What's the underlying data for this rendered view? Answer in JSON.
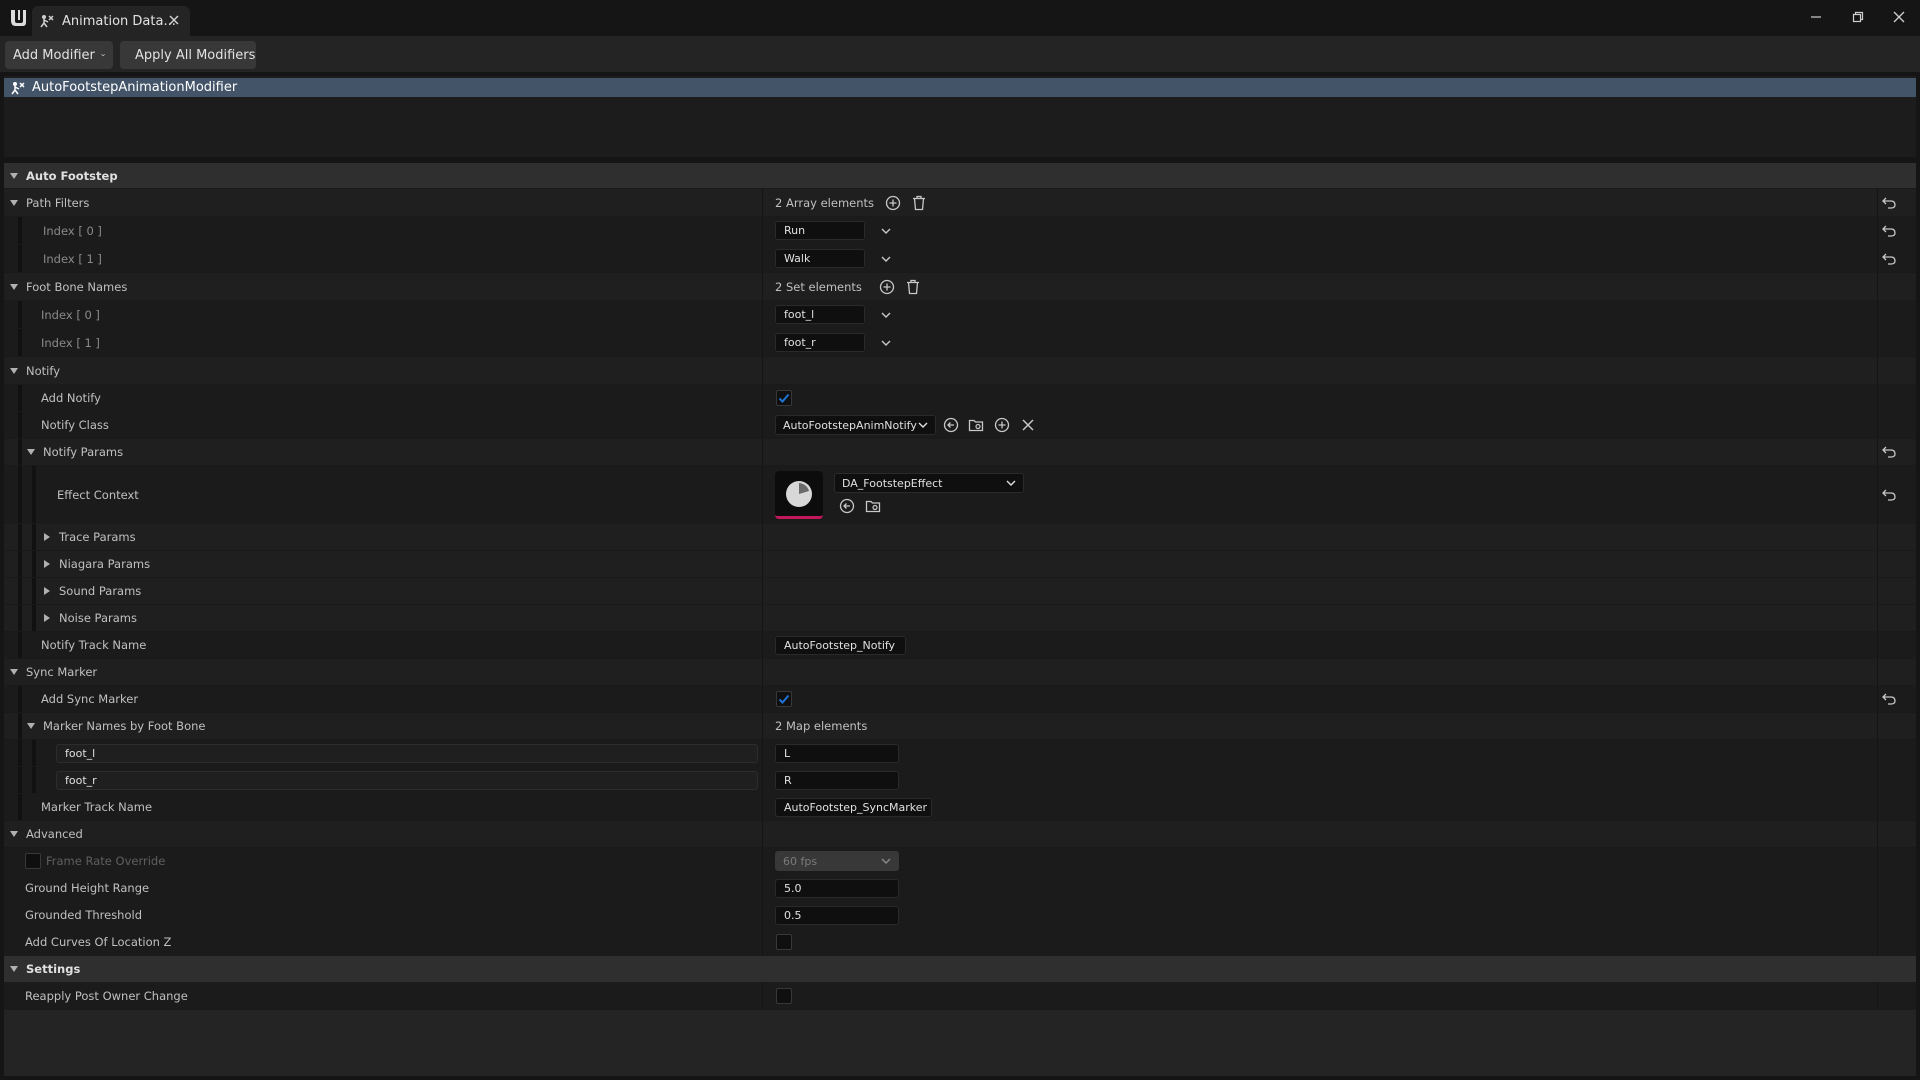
{
  "window": {
    "tab_title": "Animation Data...",
    "tab_icon": "animation-modifier-icon",
    "controls": [
      "minimize-icon",
      "restore-icon",
      "close-icon"
    ]
  },
  "toolbar": {
    "add_modifier_label": "Add Modifier",
    "apply_all_label": "Apply All Modifiers"
  },
  "modifiers": {
    "selected": "AutoFootstepAnimationModifier"
  },
  "details": {
    "auto_footstep": {
      "label": "Auto Footstep",
      "path_filters": {
        "label": "Path Filters",
        "count": "2 Array elements",
        "items": [
          {
            "index": "Index [ 0 ]",
            "value": "Run"
          },
          {
            "index": "Index [ 1 ]",
            "value": "Walk"
          }
        ]
      },
      "foot_bone_names": {
        "label": "Foot Bone Names",
        "count": "2 Set elements",
        "items": [
          {
            "index": "Index [ 0 ]",
            "value": "foot_l"
          },
          {
            "index": "Index [ 1 ]",
            "value": "foot_r"
          }
        ]
      }
    },
    "notify": {
      "label": "Notify",
      "add_notify": {
        "label": "Add Notify",
        "checked": true
      },
      "notify_class": {
        "label": "Notify Class",
        "value": "AutoFootstepAnimNotify"
      },
      "notify_params": {
        "label": "Notify Params",
        "effect_context": {
          "label": "Effect Context",
          "value": "DA_FootstepEffect"
        },
        "trace_params": "Trace Params",
        "niagara_params": "Niagara Params",
        "sound_params": "Sound Params",
        "noise_params": "Noise Params"
      },
      "notify_track_name": {
        "label": "Notify Track Name",
        "value": "AutoFootstep_Notify"
      }
    },
    "sync_marker": {
      "label": "Sync Marker",
      "add_sync_marker": {
        "label": "Add Sync Marker",
        "checked": true
      },
      "marker_names": {
        "label": "Marker Names by Foot Bone",
        "count": "2 Map elements",
        "entries": [
          {
            "key": "foot_l",
            "value": "L"
          },
          {
            "key": "foot_r",
            "value": "R"
          }
        ]
      },
      "marker_track_name": {
        "label": "Marker Track Name",
        "value": "AutoFootstep_SyncMarker"
      }
    },
    "advanced": {
      "label": "Advanced",
      "frame_rate_override": {
        "label": "Frame Rate Override",
        "value": "60 fps",
        "checked": false
      },
      "ground_height_range": {
        "label": "Ground Height Range",
        "value": "5.0"
      },
      "grounded_threshold": {
        "label": "Grounded Threshold",
        "value": "0.5"
      },
      "add_curves_location_z": {
        "label": "Add Curves Of Location Z",
        "checked": false
      }
    },
    "settings": {
      "label": "Settings",
      "reapply_post_owner_change": {
        "label": "Reapply Post Owner Change",
        "checked": false
      }
    }
  },
  "colors": {
    "accent_blue": "#1f74d6",
    "selection": "#435469",
    "thumbnail_underline": "#c2185b"
  }
}
